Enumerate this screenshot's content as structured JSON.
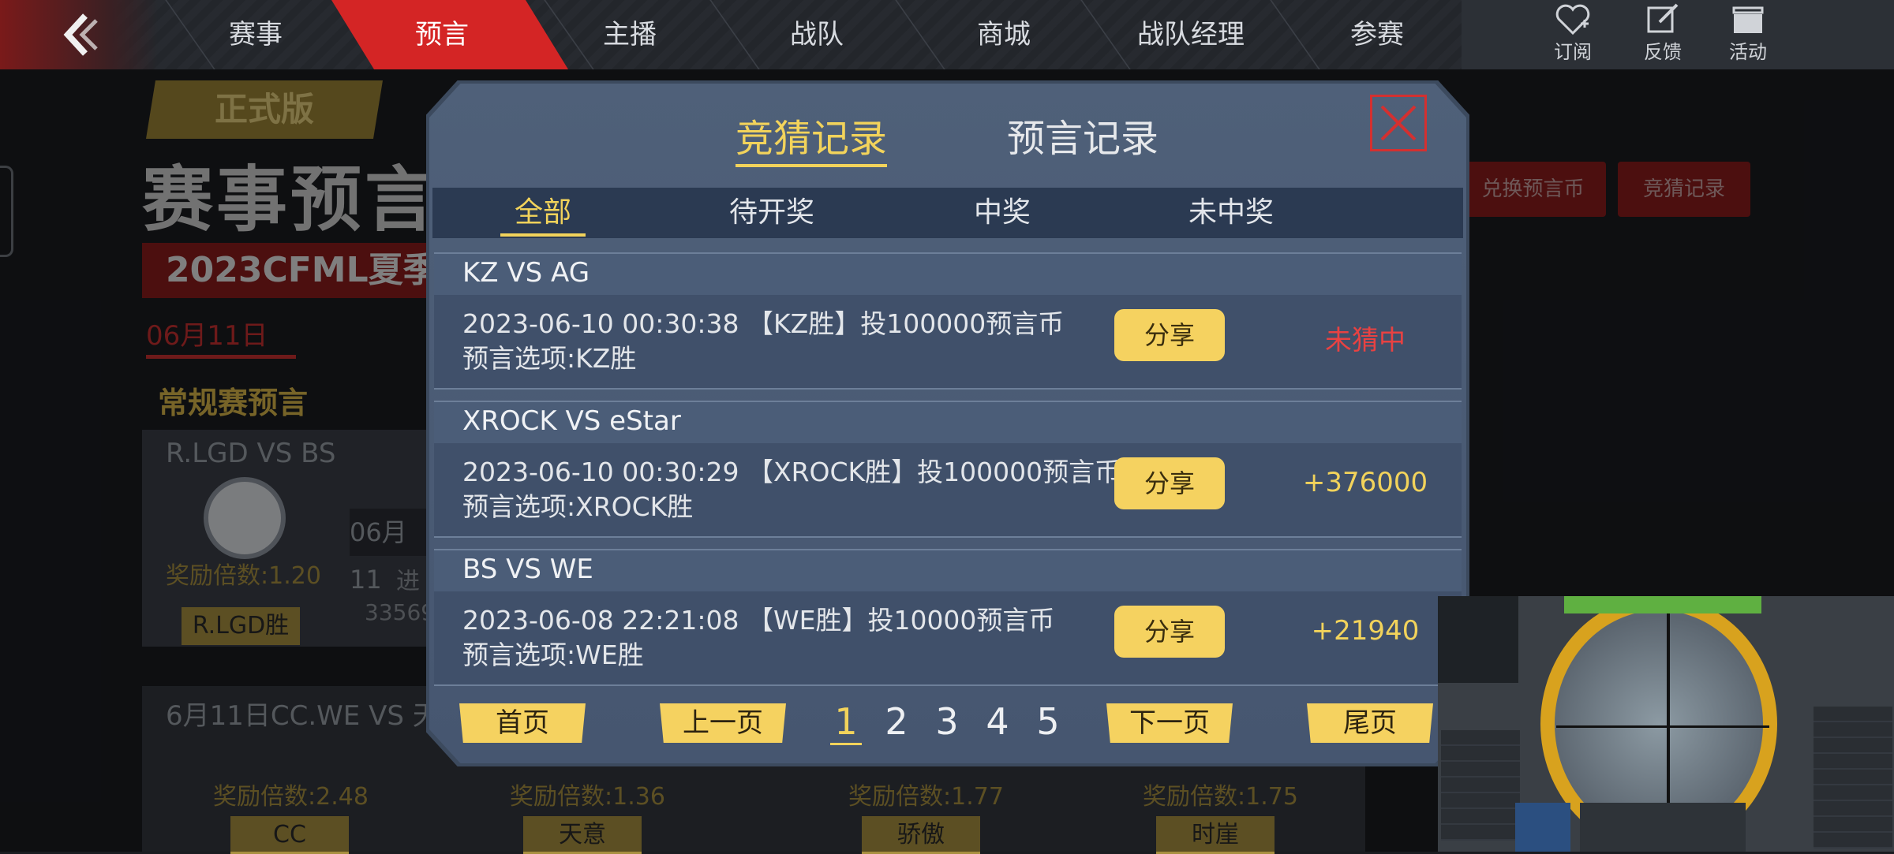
{
  "nav": {
    "tabs": [
      "赛事",
      "预言",
      "主播",
      "战队",
      "商城",
      "战队经理",
      "参赛"
    ],
    "active_tab": "预言",
    "icons": [
      {
        "name": "subscribe-icon",
        "label": "订阅"
      },
      {
        "name": "feedback-icon",
        "label": "反馈"
      },
      {
        "name": "activity-icon",
        "label": "活动"
      }
    ]
  },
  "background": {
    "version_badge": "正式版",
    "title": "赛事预言",
    "season": "2023CFML夏季",
    "date_tab": "06月11日",
    "section_title": "常规赛预言",
    "card1": {
      "head": "R.LGD VS BS",
      "rate": "奖励倍数:1.20",
      "pick": "R.LGD胜",
      "time": "06月11",
      "progress": "进",
      "count": "33569"
    },
    "right_buttons": [
      "兑换预言币",
      "竞猜记录"
    ],
    "section2_head": "6月11日CC.WE VS 天",
    "section2_rates": [
      "奖励倍数:2.48",
      "奖励倍数:1.36",
      "奖励倍数:1.77",
      "奖励倍数:1.75"
    ],
    "section2_picks": [
      "CC",
      "天意",
      "骄傲",
      "时崖"
    ]
  },
  "modal": {
    "tabs": {
      "guess": "竞猜记录",
      "predict": "预言记录"
    },
    "active_tab": "竞猜记录",
    "subtabs": [
      "全部",
      "待开奖",
      "中奖",
      "未中奖"
    ],
    "active_subtab": "全部",
    "records": [
      {
        "match": "KZ VS AG",
        "line1": "2023-06-10 00:30:38 【KZ胜】投100000预言币",
        "line2": "预言选项:KZ胜",
        "share": "分享",
        "result": "未猜中",
        "result_type": "lose"
      },
      {
        "match": "XROCK VS eStar",
        "line1": "2023-06-10 00:30:29 【XROCK胜】投100000预言币",
        "line2": "预言选项:XROCK胜",
        "share": "分享",
        "result": "+376000",
        "result_type": "win"
      },
      {
        "match": "BS VS WE",
        "line1": "2023-06-08 22:21:08 【WE胜】投10000预言币",
        "line2": "预言选项:WE胜",
        "share": "分享",
        "result": "+21940",
        "result_type": "win"
      }
    ],
    "pagination": {
      "first": "首页",
      "prev": "上一页",
      "next": "下一页",
      "last": "尾页",
      "pages": [
        "1",
        "2",
        "3",
        "4",
        "5"
      ],
      "current_page": "1"
    }
  },
  "colors": {
    "accent": "#f2d35b",
    "nav_active": "#d42525",
    "lose": "#e84242"
  }
}
